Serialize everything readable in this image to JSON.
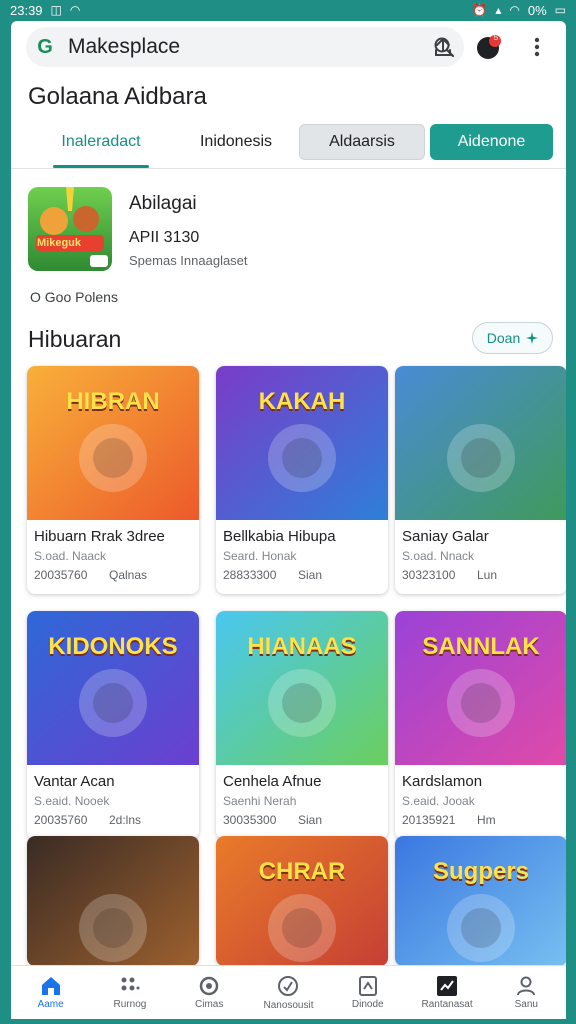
{
  "status_bar": {
    "time": "23:39",
    "battery": "0%"
  },
  "header": {
    "g_letter": "G",
    "title": "Makesplace",
    "notification_count": "5"
  },
  "user": {
    "name": "Golaana Aidbara"
  },
  "tabs": [
    {
      "label": "Inaleradact"
    },
    {
      "label": "Inidonesis"
    },
    {
      "label": "Aldaarsis"
    },
    {
      "label": "Aidenone"
    }
  ],
  "featured": {
    "name": "Abilagai",
    "version": "APII 3130",
    "subtitle": "Spemas Innaaglaset",
    "icon_text": "Mikeguk"
  },
  "pollen": {
    "label": "O  Goo Polens"
  },
  "section": {
    "title": "Hibuaran",
    "button_label": "Doan"
  },
  "cards": [
    {
      "title": "Hibuarn Rrak 3dree",
      "developer": "S.oad. Naack",
      "number": "20035760",
      "count": "Qalnas",
      "art_text": "HIBRAN",
      "colors": [
        "#f8b03a",
        "#ec5a2a"
      ]
    },
    {
      "title": "Bellkabia Hibupa",
      "developer": "Seard. Honak",
      "number": "28833300",
      "count": "Sian",
      "art_text": "KAKAH",
      "colors": [
        "#7a3cc9",
        "#2e7fd8"
      ]
    },
    {
      "title": "Saniay Galar",
      "developer": "S.oad. Nnack",
      "number": "30323100",
      "count": "Lun",
      "art_text": "",
      "colors": [
        "#4a8bd6",
        "#3f9a5b"
      ]
    },
    {
      "title": "Vantar Acan",
      "developer": "S.eaid. Nooek",
      "number": "20035760",
      "count": "2d:lns",
      "art_text": "KIDONOKS",
      "colors": [
        "#2f68d8",
        "#6b3fcf"
      ]
    },
    {
      "title": "Cenhela Afnue",
      "developer": "Saenhi Nerah",
      "number": "30035300",
      "count": "Sian",
      "art_text": "HIANAAS",
      "colors": [
        "#4ac7f0",
        "#6bcf5e"
      ]
    },
    {
      "title": "Kardslamon",
      "developer": "S.eaid. Jooak",
      "number": "20135921",
      "count": "Hm",
      "art_text": "SANNLAK",
      "colors": [
        "#9a42d8",
        "#e04aa8"
      ]
    },
    {
      "title": "",
      "developer": "",
      "number": "",
      "count": "",
      "art_text": "",
      "colors": [
        "#3a2b24",
        "#a5652f"
      ]
    },
    {
      "title": "",
      "developer": "",
      "number": "",
      "count": "",
      "art_text": "CHRAR",
      "colors": [
        "#e97b2a",
        "#c23a36"
      ]
    },
    {
      "title": "",
      "developer": "",
      "number": "",
      "count": "",
      "art_text": "Sugpers",
      "colors": [
        "#3b77e0",
        "#7bc6f2"
      ]
    }
  ],
  "bottom_nav": [
    {
      "label": "Aame",
      "icon": "home-icon"
    },
    {
      "label": "Rurnog",
      "icon": "grid-icon"
    },
    {
      "label": "Cimas",
      "icon": "games-icon"
    },
    {
      "label": "Nanosousit",
      "icon": "shield-icon"
    },
    {
      "label": "Dinode",
      "icon": "doc-icon"
    },
    {
      "label": "Rantanasat",
      "icon": "chart-icon"
    },
    {
      "label": "Sanu",
      "icon": "profile-icon"
    }
  ],
  "colors": {
    "accent": "#1e9c8f",
    "status_bar": "#1f8f86",
    "nav_active": "#1a73e8"
  }
}
